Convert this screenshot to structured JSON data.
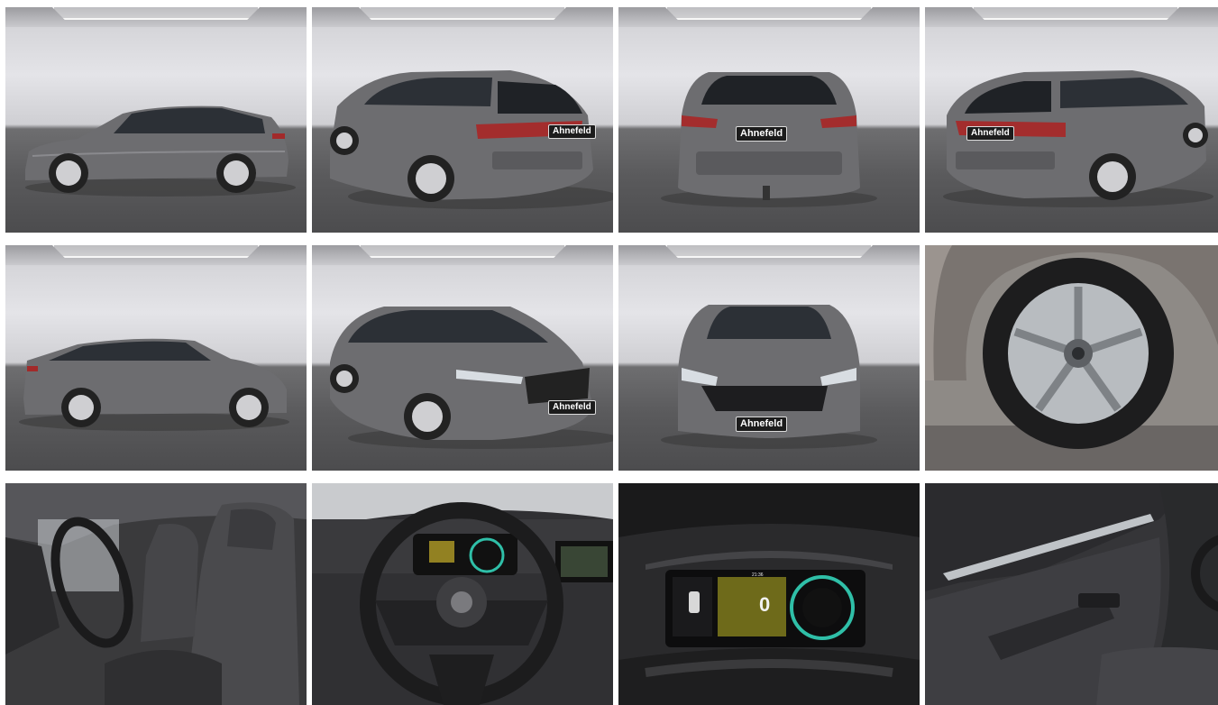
{
  "gallery": {
    "dealer_plate": "Ahnefeld",
    "speed_readout": "0",
    "clock_readout": "21:36",
    "car_color": "#6d6d70",
    "tiles": [
      {
        "view": "side-left"
      },
      {
        "view": "rear-left-three-quarter"
      },
      {
        "view": "rear"
      },
      {
        "view": "rear-right-three-quarter"
      },
      {
        "view": "side-right"
      },
      {
        "view": "front-left-three-quarter"
      },
      {
        "view": "front"
      },
      {
        "view": "wheel-detail"
      },
      {
        "view": "interior-seats"
      },
      {
        "view": "steering-wheel"
      },
      {
        "view": "instrument-cluster"
      },
      {
        "view": "door-panel"
      }
    ]
  }
}
